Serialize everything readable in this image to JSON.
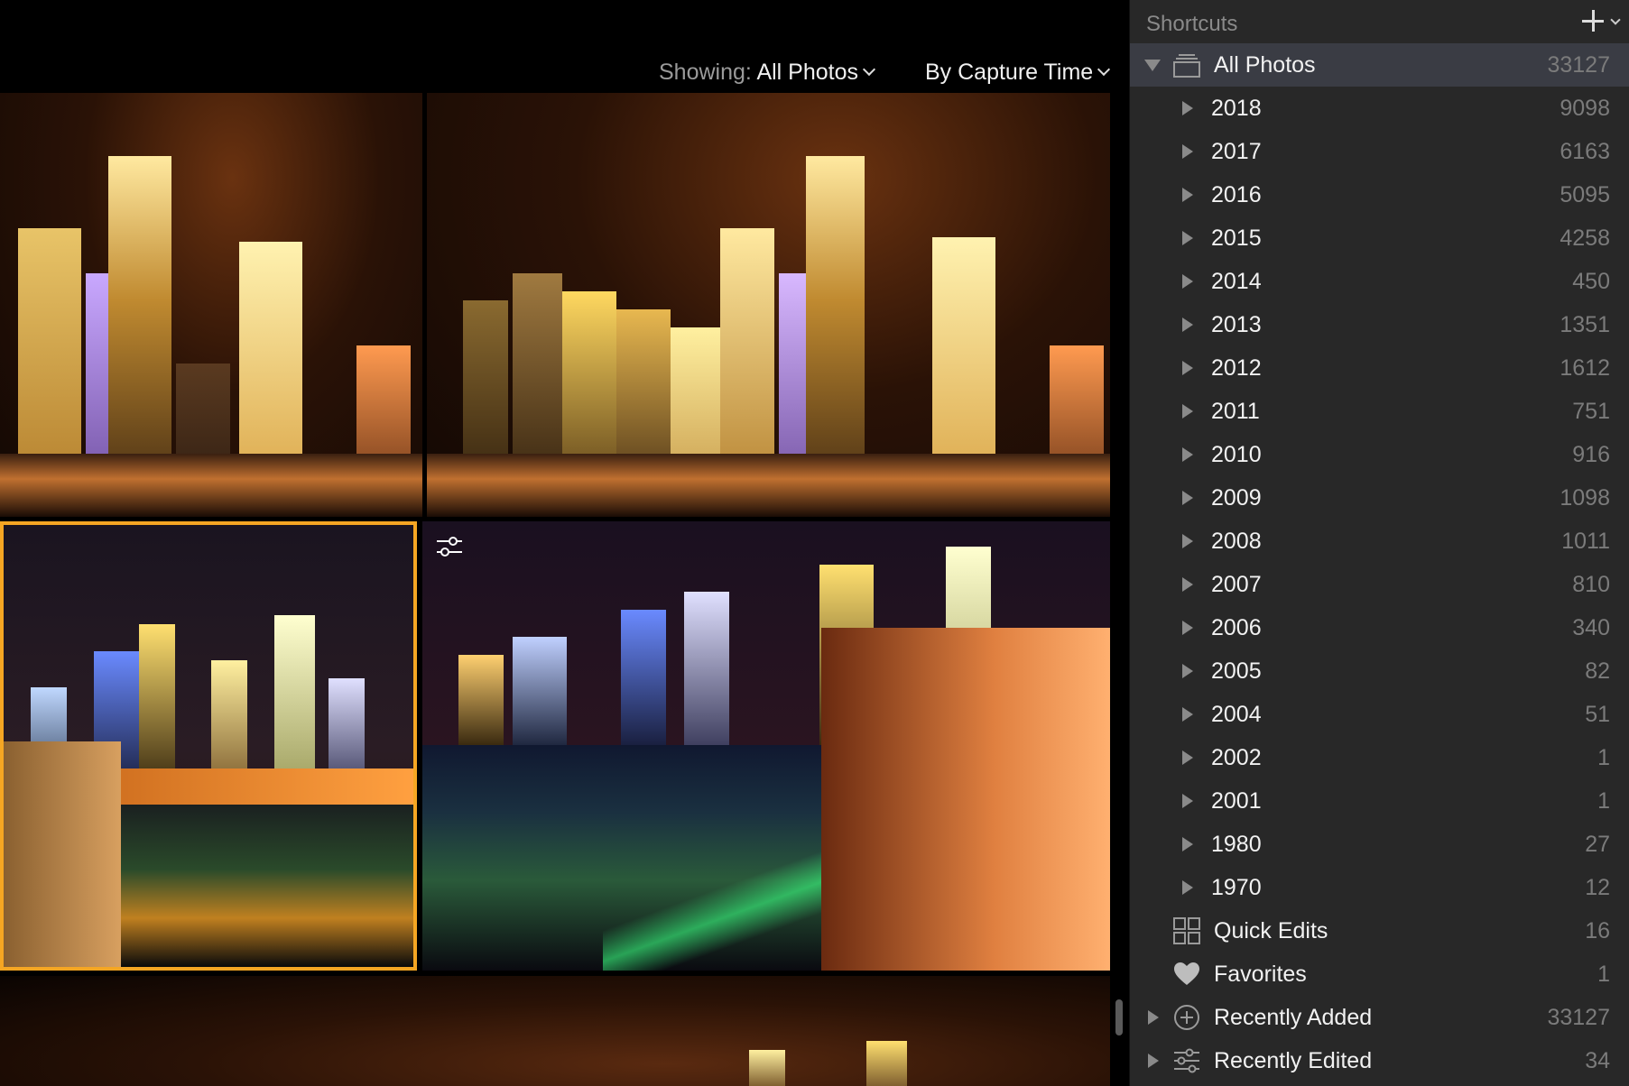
{
  "toolbar": {
    "showing_label": "Showing:",
    "showing_value": "All Photos",
    "sort_value": "By Capture Time"
  },
  "sidebar": {
    "title": "Shortcuts",
    "all_photos": {
      "label": "All Photos",
      "count": "33127"
    },
    "years": [
      {
        "label": "2018",
        "count": "9098"
      },
      {
        "label": "2017",
        "count": "6163"
      },
      {
        "label": "2016",
        "count": "5095"
      },
      {
        "label": "2015",
        "count": "4258"
      },
      {
        "label": "2014",
        "count": "450"
      },
      {
        "label": "2013",
        "count": "1351"
      },
      {
        "label": "2012",
        "count": "1612"
      },
      {
        "label": "2011",
        "count": "751"
      },
      {
        "label": "2010",
        "count": "916"
      },
      {
        "label": "2009",
        "count": "1098"
      },
      {
        "label": "2008",
        "count": "1011"
      },
      {
        "label": "2007",
        "count": "810"
      },
      {
        "label": "2006",
        "count": "340"
      },
      {
        "label": "2005",
        "count": "82"
      },
      {
        "label": "2004",
        "count": "51"
      },
      {
        "label": "2002",
        "count": "1"
      },
      {
        "label": "2001",
        "count": "1"
      },
      {
        "label": "1980",
        "count": "27"
      },
      {
        "label": "1970",
        "count": "12"
      }
    ],
    "quick_edits": {
      "label": "Quick Edits",
      "count": "16",
      "icon": "grid-icon"
    },
    "favorites": {
      "label": "Favorites",
      "count": "1",
      "icon": "heart-icon"
    },
    "recently_added": {
      "label": "Recently Added",
      "count": "33127",
      "icon": "plus-circle-icon"
    },
    "recently_edited": {
      "label": "Recently Edited",
      "count": "34",
      "icon": "sliders-icon"
    }
  },
  "colors": {
    "selection_border": "#f5a623",
    "sidebar_bg": "#282828",
    "selected_row_bg": "#3a3c44"
  }
}
